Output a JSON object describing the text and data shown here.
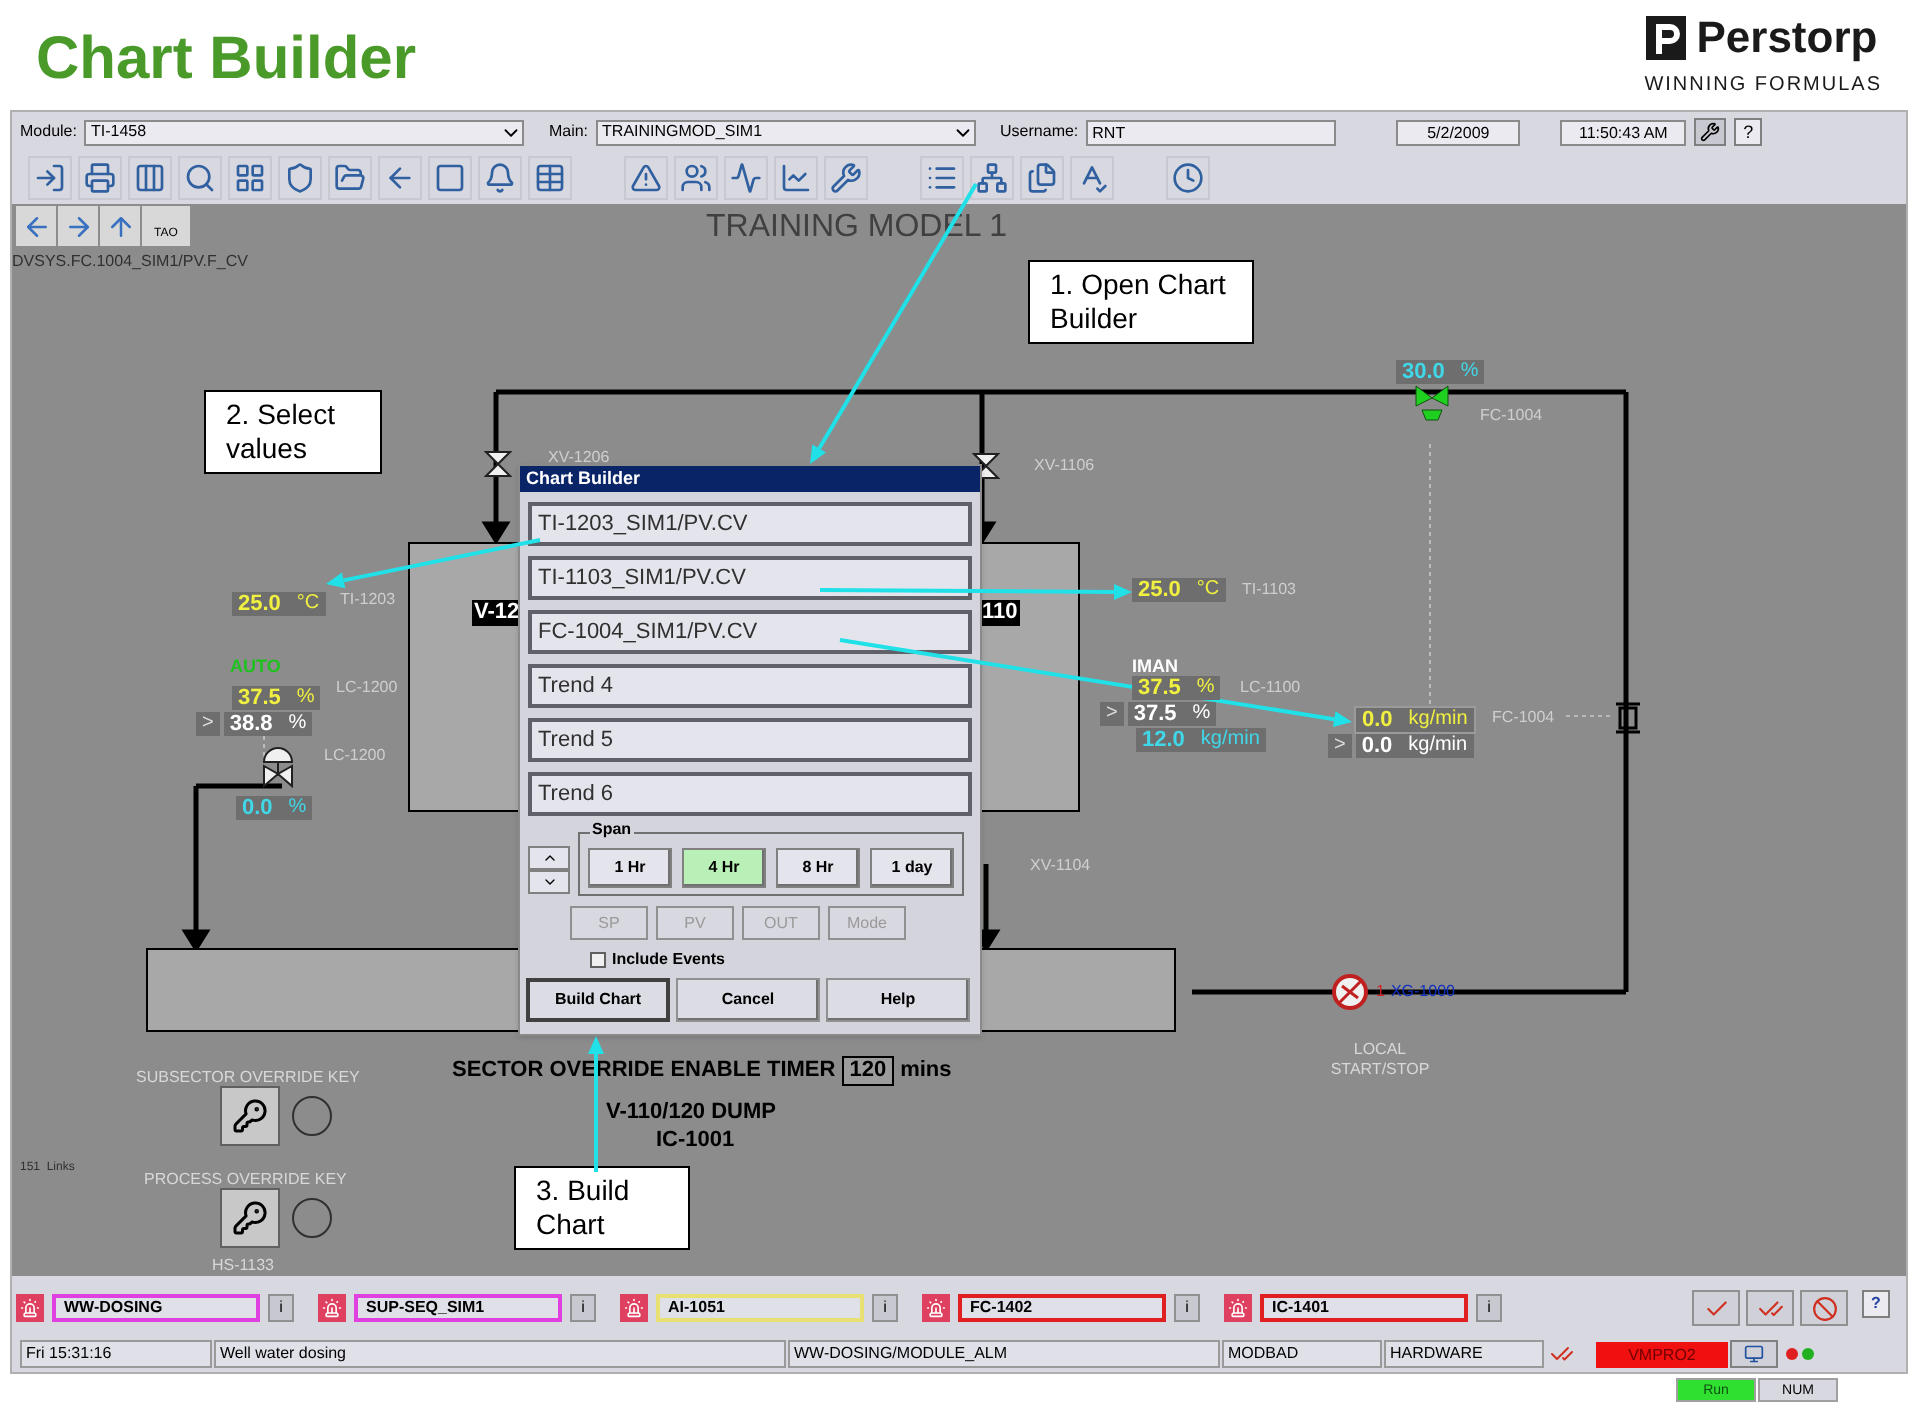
{
  "header": {
    "title": "Chart Builder",
    "logo_name": "Perstorp",
    "logo_tagline": "WINNING FORMULAS"
  },
  "top_bar": {
    "module_label": "Module:",
    "module_value": "TI-1458",
    "main_label": "Main:",
    "main_value": "TRAININGMOD_SIM1",
    "username_label": "Username:",
    "username_value": "RNT",
    "date": "5/2/2009",
    "time": "11:50:43 AM",
    "help": "?"
  },
  "display": {
    "nav_tab": "TAO",
    "tag_path": "DVSYS.FC.1004_SIM1/PV.F_CV",
    "title": "TRAINING MODEL 1"
  },
  "callouts": [
    "1. Open Chart Builder",
    "2. Select values",
    "3. Build Chart"
  ],
  "tags": [
    "XV-1206",
    "XV-1106",
    "XV-1104",
    "FC-1004",
    "TI-1203",
    "LC-1200",
    "LC-1200",
    "TI-1103",
    "LC-1100",
    "FC-1004"
  ],
  "readouts": [
    {
      "kind": "output",
      "value": "30.0",
      "unit": "%"
    },
    {
      "kind": "process",
      "value": "25.0",
      "unit": "°C"
    },
    {
      "kind": "process",
      "value": "37.5",
      "unit": "%"
    },
    {
      "kind": "setpoint",
      "prefix": ">",
      "value": "38.8",
      "unit": "%"
    },
    {
      "kind": "output",
      "value": "0.0",
      "unit": "%"
    },
    {
      "kind": "process",
      "value": "25.0",
      "unit": "°C"
    },
    {
      "kind": "process",
      "value": "37.5",
      "unit": "%"
    },
    {
      "kind": "setpoint",
      "prefix": ">",
      "value": "37.5",
      "unit": "%"
    },
    {
      "kind": "output",
      "value": "12.0",
      "unit": "kg/min"
    },
    {
      "kind": "process",
      "value": "0.0",
      "unit": "kg/min"
    },
    {
      "kind": "setpoint",
      "prefix": ">",
      "value": "0.0",
      "unit": "kg/min"
    }
  ],
  "modes": [
    {
      "kind": "auto",
      "text": "AUTO"
    },
    {
      "kind": "manual",
      "text": "IMAN"
    }
  ],
  "vessels": [
    "V-12",
    "110"
  ],
  "valve": {
    "count": "1",
    "tag": "XG-1000",
    "label": "LOCAL START/STOP"
  },
  "sector": {
    "label": "SECTOR OVERRIDE ENABLE TIMER",
    "value": "120",
    "unit": "mins",
    "dump": "V-110/120 DUMP",
    "controller": "IC-1001"
  },
  "keys": {
    "subsector": "SUBSECTOR OVERRIDE KEY",
    "process": "PROCESS OVERRIDE KEY",
    "links": "151  Links",
    "switch_tag": "HS-1133"
  },
  "dialog": {
    "title": "Chart Builder",
    "trends": [
      "TI-1203_SIM1/PV.CV",
      "TI-1103_SIM1/PV.CV",
      "FC-1004_SIM1/PV.CV",
      "Trend 4",
      "Trend 5",
      "Trend 6"
    ],
    "span_label": "Span",
    "spans": [
      {
        "label": "1 Hr",
        "selected": false
      },
      {
        "label": "4 Hr",
        "selected": true
      },
      {
        "label": "8 Hr",
        "selected": false
      },
      {
        "label": "1 day",
        "selected": false
      }
    ],
    "params": [
      {
        "label": "SP",
        "disabled": true
      },
      {
        "label": "PV",
        "disabled": true
      },
      {
        "label": "OUT",
        "disabled": true
      },
      {
        "label": "Mode",
        "disabled": true
      }
    ],
    "include_events": {
      "label": "Include Events",
      "checked": false
    },
    "buttons": [
      {
        "label": "Build Chart",
        "selected": true
      },
      {
        "label": "Cancel",
        "selected": false
      },
      {
        "label": "Help",
        "selected": false
      }
    ]
  },
  "alarms": [
    {
      "name": "WW-DOSING",
      "color": "#e040e0",
      "info": "i"
    },
    {
      "name": "SUP-SEQ_SIM1",
      "color": "#e040e0",
      "info": "i"
    },
    {
      "name": "AI-1051",
      "color": "#e8e070",
      "info": "i"
    },
    {
      "name": "FC-1402",
      "color": "#e02020",
      "info": "i"
    },
    {
      "name": "IC-1401",
      "color": "#e02020",
      "info": "i"
    }
  ],
  "alarm_help": "?",
  "status_bar": {
    "fields": [
      "Fri 15:31:16",
      "Well water dosing",
      "WW-DOSING/MODULE_ALM",
      "MODBAD",
      "HARDWARE"
    ],
    "node": "VMPRO2"
  },
  "indicators": [
    {
      "label": "Run",
      "on": true
    },
    {
      "label": "NUM",
      "on": false
    }
  ]
}
